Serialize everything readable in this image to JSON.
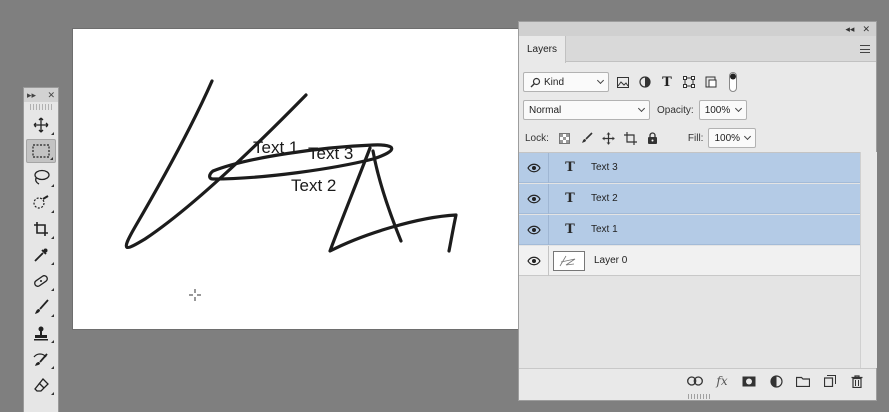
{
  "canvas": {
    "texts": [
      "Text 1",
      "Text 3",
      "Text 2"
    ]
  },
  "tools": {
    "header_left": "▸▸",
    "header_right": "✕",
    "items": [
      {
        "name": "move-tool-icon"
      },
      {
        "name": "marquee-tool-icon",
        "active": true
      },
      {
        "name": "lasso-tool-icon"
      },
      {
        "name": "quick-selection-tool-icon"
      },
      {
        "name": "crop-tool-icon"
      },
      {
        "name": "eyedropper-tool-icon"
      },
      {
        "name": "healing-brush-tool-icon"
      },
      {
        "name": "brush-tool-icon"
      },
      {
        "name": "clone-stamp-tool-icon"
      },
      {
        "name": "history-brush-tool-icon"
      },
      {
        "name": "eraser-tool-icon"
      }
    ]
  },
  "panel": {
    "collapse_glyph": "◂◂",
    "close_glyph": "✕",
    "tab_label": "Layers",
    "filter_kind": "Kind",
    "blend_mode": "Normal",
    "opacity_label": "Opacity:",
    "opacity_value": "100%",
    "lock_label": "Lock:",
    "fill_label": "Fill:",
    "fill_value": "100%",
    "layers": [
      {
        "name": "Text 3",
        "type": "text",
        "selected": true
      },
      {
        "name": "Text 2",
        "type": "text",
        "selected": true
      },
      {
        "name": "Text 1",
        "type": "text",
        "selected": true
      },
      {
        "name": "Layer 0",
        "type": "pixel",
        "selected": false
      }
    ],
    "text_glyph": "T",
    "fx_label": "fx"
  }
}
